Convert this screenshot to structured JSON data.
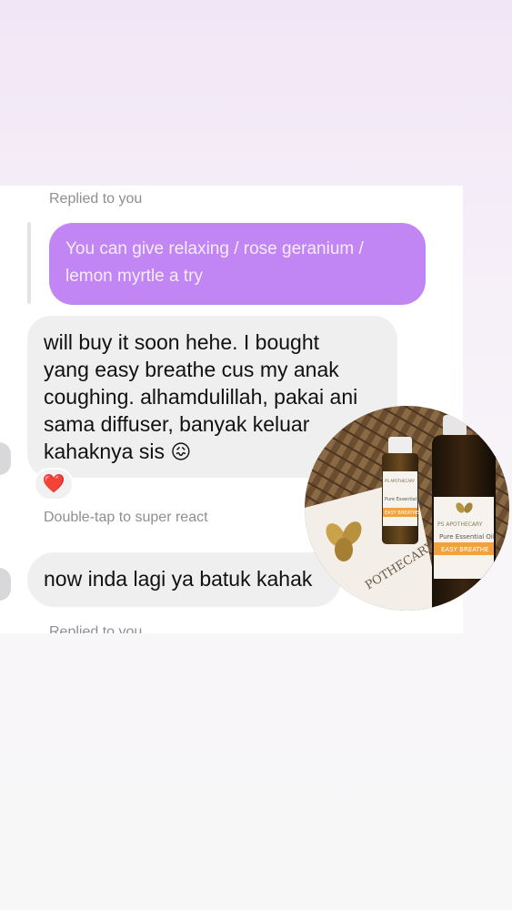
{
  "thread": {
    "reply_label_top": "Replied to you",
    "quoted_message": "You can give relaxing / rose geranium / lemon myrtle a try",
    "message_1_lines": [
      "will buy it soon hehe. I bought",
      "yang easy breathe cus my anak",
      "coughing. alhamdulillah, pakai ani",
      "sama diffuser, banyak keluar",
      "kahaknya sis"
    ],
    "message_1_emoji": "😖",
    "reaction_emoji": "❤️",
    "super_react_hint": "Double-tap to super react",
    "message_2": "now inda lagi ya batuk kahak",
    "reply_label_bottom": "Replied to you"
  },
  "product_photo": {
    "box_text": "POTHECARY",
    "small_label_brand": "PS APOTHECARY",
    "small_label_title": "Pure Essential Oil",
    "small_label_name": "EASY BREATHE",
    "big_label_brand": "PS APOTHECARY",
    "big_label_title": "Pure Essential Oil",
    "big_label_name": "EASY BREATHE"
  }
}
